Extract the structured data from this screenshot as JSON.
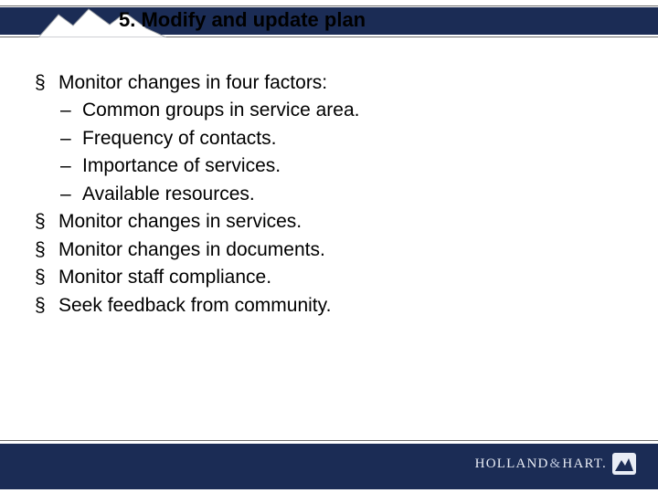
{
  "title": "5.  Modify and update plan",
  "bullets": [
    {
      "text": "Monitor changes in four factors:",
      "subs": [
        "Common groups in service area.",
        "Frequency of contacts.",
        "Importance of services.",
        "Available resources."
      ]
    },
    {
      "text": "Monitor changes in services."
    },
    {
      "text": "Monitor changes in documents."
    },
    {
      "text": "Monitor staff compliance."
    },
    {
      "text": "Seek feedback from community."
    }
  ],
  "footer": {
    "company1": "HOLLAND",
    "amp": "&",
    "company2": "HART",
    "suffix": "."
  }
}
